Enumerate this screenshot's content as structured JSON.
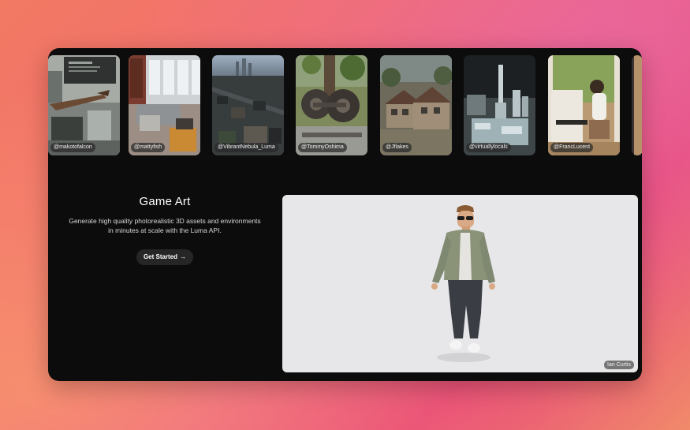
{
  "gallery": {
    "items": [
      {
        "handle": "@makotofalcon"
      },
      {
        "handle": "@mattyfish"
      },
      {
        "handle": "@VibrantNebula_Luma"
      },
      {
        "handle": "@TommyOshima"
      },
      {
        "handle": "@Jflakes"
      },
      {
        "handle": "@virtuallylocals"
      },
      {
        "handle": "@FrancLucent"
      }
    ]
  },
  "hero": {
    "title": "Game Art",
    "description": "Generate high quality photorealistic 3D assets and environments in minutes at scale with the Luma API.",
    "cta_label": "Get Started",
    "cta_arrow": "→"
  },
  "viewer": {
    "credit": "Ian Curtis"
  },
  "colors": {
    "window_bg": "#0c0c0c",
    "viewer_bg": "#e7e7e9",
    "button_bg": "#262626"
  }
}
